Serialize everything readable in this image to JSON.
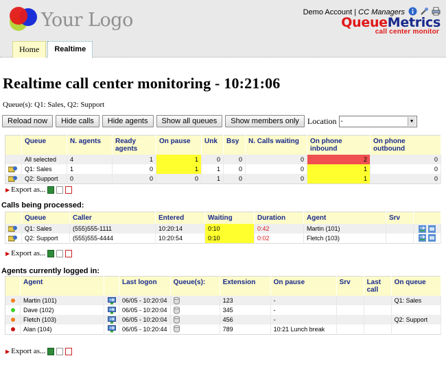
{
  "header": {
    "logo_text": "Your Logo",
    "account_name": "Demo Account",
    "separator": "|",
    "group_name": "CC Managers",
    "brand_queue": "Queue",
    "brand_metrics": "Metrics",
    "brand_sub": "call center monitor",
    "icons": [
      "info-icon",
      "wrench-icon",
      "print-icon"
    ]
  },
  "tabs": [
    {
      "label": "Home",
      "active": false
    },
    {
      "label": "Realtime",
      "active": true
    }
  ],
  "page_title": "Realtime call center monitoring - 10:21:06",
  "queues_line": "Queue(s): Q1: Sales, Q2: Support",
  "buttons": {
    "reload": "Reload now",
    "hide_calls": "Hide calls",
    "hide_agents": "Hide agents",
    "show_all": "Show all queues",
    "show_members": "Show members only"
  },
  "location": {
    "label": "Location",
    "value": "-"
  },
  "queue_table": {
    "headers": [
      "Queue",
      "N. agents",
      "Ready agents",
      "On pause",
      "Unk",
      "Bsy",
      "N. Calls waiting",
      "On phone inbound",
      "On phone outbound"
    ],
    "rows": [
      {
        "queue": "All selected",
        "agents": "4",
        "ready": "1",
        "pause": "1",
        "unk": "0",
        "bsy": "0",
        "waiting": "0",
        "inbound": "2",
        "outbound": "0"
      },
      {
        "queue": "Q1: Sales",
        "agents": "1",
        "ready": "0",
        "pause": "1",
        "unk": "1",
        "bsy": "0",
        "waiting": "0",
        "inbound": "1",
        "outbound": "0"
      },
      {
        "queue": "Q2: Support",
        "agents": "0",
        "ready": "0",
        "pause": "0",
        "unk": "1",
        "bsy": "0",
        "waiting": "0",
        "inbound": "1",
        "outbound": "0"
      }
    ]
  },
  "export_label": "Export as...",
  "calls_title": "Calls being processed:",
  "calls_table": {
    "headers": [
      "Queue",
      "Caller",
      "Entered",
      "Waiting",
      "Duration",
      "Agent",
      "Srv"
    ],
    "rows": [
      {
        "queue": "Q1: Sales",
        "caller": "(555)555-1111",
        "entered": "10:20:14",
        "waiting": "0:10",
        "duration": "0:42",
        "agent": "Martin (101)",
        "srv": ""
      },
      {
        "queue": "Q2: Support",
        "caller": "(555)555-4444",
        "entered": "10:20:54",
        "waiting": "0:10",
        "duration": "0:02",
        "agent": "Fletch (103)",
        "srv": ""
      }
    ]
  },
  "agents_title": "Agents currently logged in:",
  "agents_table": {
    "headers": [
      "Agent",
      "Last logon",
      "Queue(s):",
      "Extension",
      "On pause",
      "Srv",
      "Last call",
      "On queue"
    ],
    "rows": [
      {
        "status_color": "#f07e1a",
        "agent": "Martin (101)",
        "logon": "06/05 - 10:20:04",
        "extension": "123",
        "pause": "-",
        "srv": "",
        "last_call": "",
        "on_queue": "Q1: Sales"
      },
      {
        "status_color": "#3fcf2a",
        "agent": "Dave (102)",
        "logon": "06/05 - 10:20:04",
        "extension": "345",
        "pause": "-",
        "srv": "",
        "last_call": "",
        "on_queue": ""
      },
      {
        "status_color": "#f07e1a",
        "agent": "Fletch (103)",
        "logon": "06/05 - 10:20:04",
        "extension": "456",
        "pause": "-",
        "srv": "",
        "last_call": "",
        "on_queue": "Q2: Support"
      },
      {
        "status_color": "#c81414",
        "agent": "Alan (104)",
        "logon": "06/05 - 10:20:44",
        "extension": "789",
        "pause": "10:21 Lunch break",
        "srv": "",
        "last_call": "",
        "on_queue": ""
      }
    ]
  },
  "colors": {
    "header_bg": "#e9e9e9",
    "table_header_bg": "#fdfbc9",
    "table_header_text": "#1a2a8c",
    "highlight_yellow": "#ffff2e",
    "highlight_red": "#f05050",
    "brand_red": "#e01818",
    "brand_blue": "#1a2a8c"
  }
}
